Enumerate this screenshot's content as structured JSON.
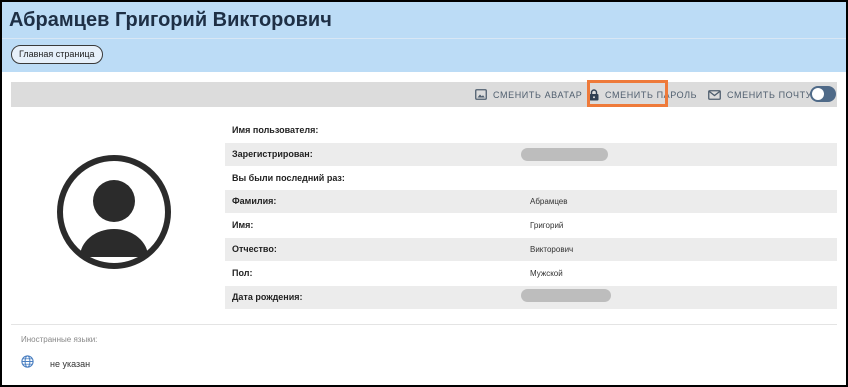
{
  "header": {
    "title": "Абрамцев Григорий Викторович",
    "home_button": "Главная страница",
    "background": "#bcdcf6"
  },
  "toolbar": {
    "change_avatar": "СМЕНИТЬ АВАТАР",
    "change_password": "СМЕНИТЬ ПАРОЛЬ",
    "change_email": "СМЕНИТЬ ПОЧТУ",
    "highlight_color": "#ee7a3a",
    "toggle_color": "#4f6a88"
  },
  "avatar": {
    "icon": "user-avatar-icon"
  },
  "profile": {
    "username": {
      "label": "Имя пользователя:",
      "value": ""
    },
    "registered": {
      "label": "Зарегистрирован:",
      "value": ""
    },
    "last_seen": {
      "label": "Вы были последний раз:",
      "value": ""
    },
    "last_name": {
      "label": "Фамилия:",
      "value": "Абрамцев"
    },
    "first_name": {
      "label": "Имя:",
      "value": "Григорий"
    },
    "patronymic": {
      "label": "Отчество:",
      "value": "Викторович"
    },
    "gender": {
      "label": "Пол:",
      "value": "Мужской"
    },
    "birth_date": {
      "label": "Дата рождения:",
      "value": ""
    }
  },
  "languages": {
    "label": "Иностранные языки:",
    "value": "не указан",
    "icon": "globe-icon"
  }
}
